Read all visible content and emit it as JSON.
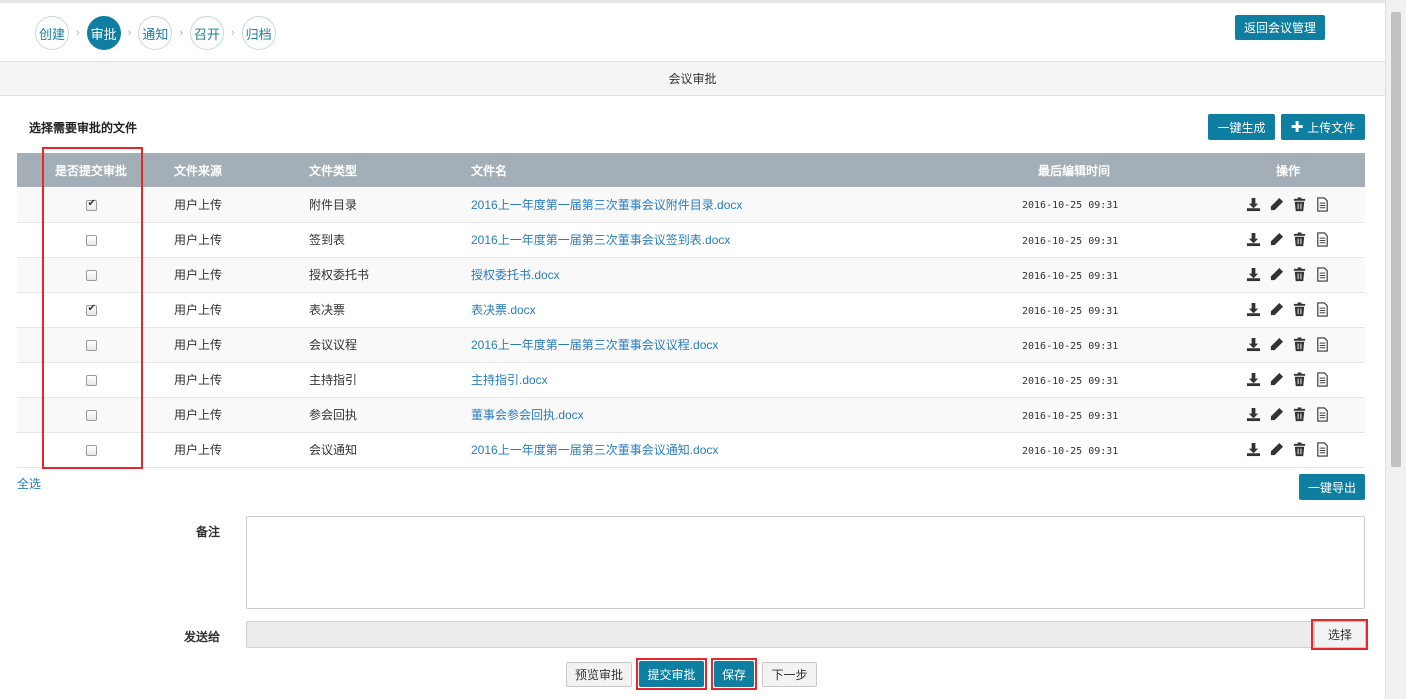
{
  "steps": [
    "创建",
    "审批",
    "通知",
    "召开",
    "归档"
  ],
  "active_step": "审批",
  "return_button": "返回会议管理",
  "section_title": "会议审批",
  "select_files_label": "选择需要审批的文件",
  "generate_button": "一键生成",
  "upload_button": "上传文件",
  "table": {
    "headers": [
      "是否提交审批",
      "文件来源",
      "文件类型",
      "文件名",
      "最后编辑时间",
      "操作"
    ],
    "rows": [
      {
        "checked": true,
        "source": "用户上传",
        "type": "附件目录",
        "name": "2016上一年度第一届第三次董事会议附件目录.docx",
        "time": "2016-10-25 09:31"
      },
      {
        "checked": false,
        "source": "用户上传",
        "type": "签到表",
        "name": "2016上一年度第一届第三次董事会议签到表.docx",
        "time": "2016-10-25 09:31"
      },
      {
        "checked": false,
        "source": "用户上传",
        "type": "授权委托书",
        "name": "授权委托书.docx",
        "time": "2016-10-25 09:31"
      },
      {
        "checked": true,
        "source": "用户上传",
        "type": "表决票",
        "name": "表决票.docx",
        "time": "2016-10-25 09:31"
      },
      {
        "checked": false,
        "source": "用户上传",
        "type": "会议议程",
        "name": "2016上一年度第一届第三次董事会议议程.docx",
        "time": "2016-10-25 09:31"
      },
      {
        "checked": false,
        "source": "用户上传",
        "type": "主持指引",
        "name": "主持指引.docx",
        "time": "2016-10-25 09:31"
      },
      {
        "checked": false,
        "source": "用户上传",
        "type": "参会回执",
        "name": "董事会参会回执.docx",
        "time": "2016-10-25 09:31"
      },
      {
        "checked": false,
        "source": "用户上传",
        "type": "会议通知",
        "name": "2016上一年度第一届第三次董事会议通知.docx",
        "time": "2016-10-25 09:31"
      }
    ],
    "row_actions": [
      "download-icon",
      "edit-pencil-icon",
      "delete-trash-icon",
      "document-icon"
    ]
  },
  "select_all": "全选",
  "export_button": "一键导出",
  "remark_label": "备注",
  "remark_value": "",
  "send_to_label": "发送给",
  "send_to_value": "",
  "choose_button": "选择",
  "footer_buttons": {
    "preview": "预览审批",
    "submit": "提交审批",
    "save": "保存",
    "next": "下一步"
  },
  "colors": {
    "primary": "#0e7fa1",
    "table_header": "#a3aeb6",
    "link": "#2a7cc0",
    "highlight_box": "#e8262a"
  }
}
